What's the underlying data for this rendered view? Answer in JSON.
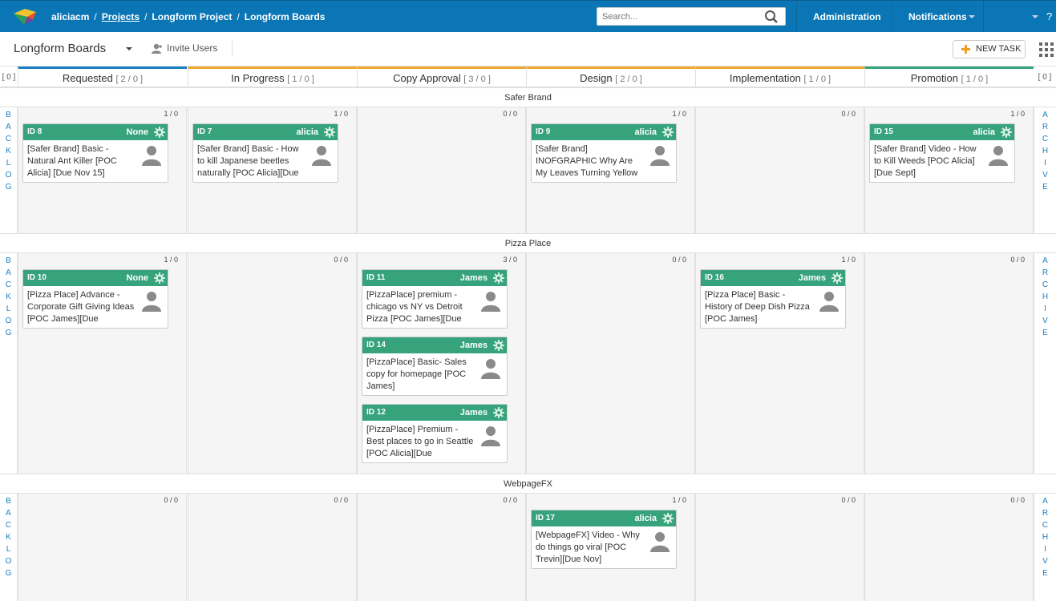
{
  "topbar": {
    "user": "aliciacm",
    "crumb_projects": "Projects",
    "crumb_project": "Longform Project",
    "crumb_board": "Longform Boards",
    "search_placeholder": "Search...",
    "nav_admin": "Administration",
    "nav_notifications": "Notifications",
    "help": "?"
  },
  "subbar": {
    "board_title": "Longform Boards",
    "invite_label": "Invite Users",
    "new_task_label": "NEW TASK"
  },
  "side": {
    "backlog_count": "[ 0 ]",
    "archive_count": "[ 0 ]",
    "backlog_letters": [
      "B",
      "A",
      "C",
      "K",
      "L",
      "O",
      "G"
    ],
    "archive_letters": [
      "A",
      "R",
      "C",
      "H",
      "I",
      "V",
      "E"
    ]
  },
  "columns": [
    {
      "name": "Requested",
      "count": "[ 2 / 0 ]",
      "color": "#1b7fc3"
    },
    {
      "name": "In Progress",
      "count": "[ 1 / 0 ]",
      "color": "#f0a830"
    },
    {
      "name": "Copy Approval",
      "count": "[ 3 / 0 ]",
      "color": "#f0a830"
    },
    {
      "name": "Design",
      "count": "[ 2 / 0 ]",
      "color": "#f0a830"
    },
    {
      "name": "Implementation",
      "count": "[ 1 / 0 ]",
      "color": "#f0a830"
    },
    {
      "name": "Promotion",
      "count": "[ 1 / 0 ]",
      "color": "#36a37d"
    }
  ],
  "lanes": [
    {
      "name": "Safer Brand",
      "counts": [
        "1 / 0",
        "1 / 0",
        "0 / 0",
        "1 / 0",
        "0 / 0",
        "1 / 0"
      ],
      "cards": [
        {
          "col": 0,
          "id": "ID 8",
          "owner": "None",
          "text": "[Safer Brand] Basic - Natural Ant Killer [POC Alicia] [Due Nov 15]"
        },
        {
          "col": 1,
          "id": "ID 7",
          "owner": "alicia",
          "text": "[Safer Brand] Basic - How to kill Japanese beetles naturally [POC Alicia][Due"
        },
        {
          "col": 3,
          "id": "ID 9",
          "owner": "alicia",
          "text": "[Safer Brand] INOFGRAPHIC Why Are My Leaves Turning Yellow"
        },
        {
          "col": 5,
          "id": "ID 15",
          "owner": "alicia",
          "text": "[Safer Brand] Video - How to Kill Weeds [POC Alicia] [Due Sept]"
        }
      ]
    },
    {
      "name": "Pizza Place",
      "counts": [
        "1 / 0",
        "0 / 0",
        "3 / 0",
        "0 / 0",
        "1 / 0",
        "0 / 0"
      ],
      "cards": [
        {
          "col": 0,
          "id": "ID 10",
          "owner": "None",
          "text": "[Pizza Place] Advance - Corporate Gift Giving Ideas [POC James][Due"
        },
        {
          "col": 2,
          "id": "ID 11",
          "owner": "James",
          "text": "[PizzaPlace] premium - chicago vs NY vs Detroit Pizza [POC James][Due"
        },
        {
          "col": 2,
          "id": "ID 14",
          "owner": "James",
          "text": "[PizzaPlace] Basic- Sales copy for homepage [POC James]"
        },
        {
          "col": 2,
          "id": "ID 12",
          "owner": "James",
          "text": "[PizzaPlace] Premium - Best places to go in Seattle [POC Alicia][Due"
        },
        {
          "col": 4,
          "id": "ID 16",
          "owner": "James",
          "text": "[Pizza Place] Basic - History of Deep Dish Pizza [POC James]"
        }
      ]
    },
    {
      "name": "WebpageFX",
      "counts": [
        "0 / 0",
        "0 / 0",
        "0 / 0",
        "1 / 0",
        "0 / 0",
        "0 / 0"
      ],
      "cards": [
        {
          "col": 3,
          "id": "ID 17",
          "owner": "alicia",
          "text": "[WebpageFX] Video - Why do things go viral [POC Trevin][Due Nov]"
        }
      ]
    }
  ]
}
